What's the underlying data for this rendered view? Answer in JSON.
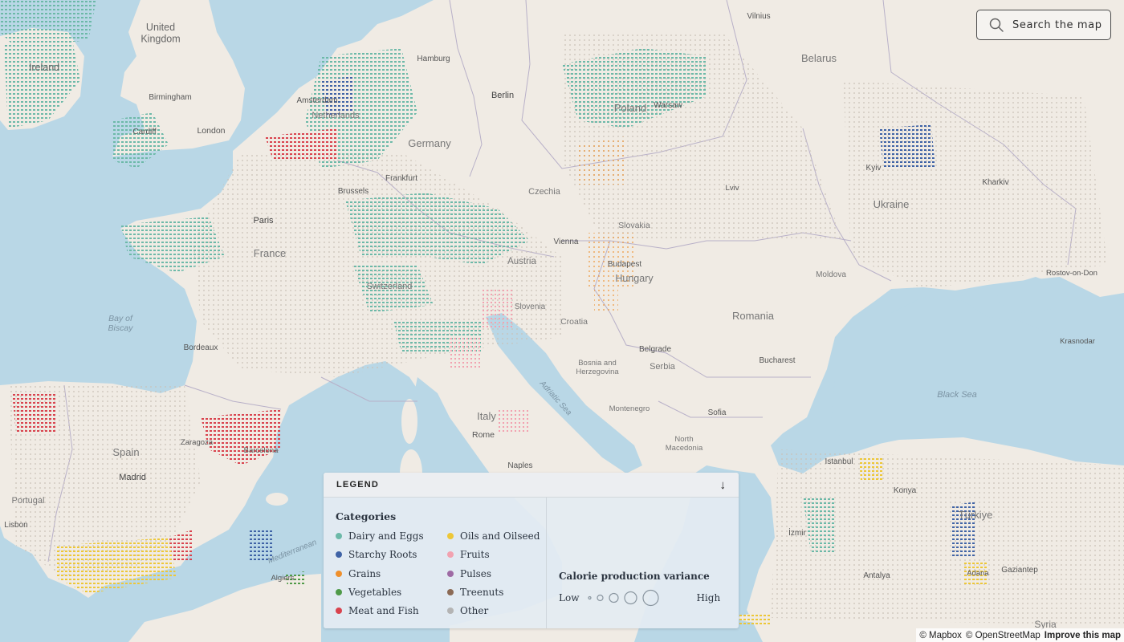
{
  "colors": {
    "water": "#b9d7e6",
    "land": "#f0ebe4",
    "dairy_eggs": "#6cb9a8",
    "starchy_roots": "#3f63a6",
    "grains": "#ef8f2b",
    "vegetables": "#4f9a48",
    "meat_fish": "#d9434e",
    "oils_oilseed": "#edc737",
    "fruits": "#f2a2b0",
    "pulses": "#9e6aa4",
    "treenuts": "#8b6a55",
    "other": "#b4b4b4"
  },
  "search": {
    "placeholder": "Search the map",
    "icon": "search-icon"
  },
  "map_labels": {
    "united_kingdom": "United\nKingdom",
    "ireland": "Ireland",
    "birmingham": "Birmingham",
    "cardiff": "Cardiff",
    "london": "London",
    "amsterdam": "Amsterdam",
    "netherlands": "Netherlands",
    "hamburg": "Hamburg",
    "berlin": "Berlin",
    "germany": "Germany",
    "frankfurt": "Frankfurt",
    "brussels": "Brussels",
    "paris": "Paris",
    "france": "France",
    "bay_of_biscay": "Bay of\nBiscay",
    "bordeaux": "Bordeaux",
    "switzerland": "Switzerland",
    "poland": "Poland",
    "warsaw": "Warsaw",
    "czechia": "Czechia",
    "vienna": "Vienna",
    "austria": "Austria",
    "slovakia": "Slovakia",
    "budapest": "Budapest",
    "hungary": "Hungary",
    "slovenia": "Slovenia",
    "croatia": "Croatia",
    "bosnia": "Bosnia and\nHerzegovina",
    "serbia": "Serbia",
    "belgrade": "Belgrade",
    "montenegro": "Montenegro",
    "north_macedonia": "North\nMacedonia",
    "sofia": "Sofia",
    "romania": "Romania",
    "bucharest": "Bucharest",
    "moldova": "Moldova",
    "ukraine": "Ukraine",
    "kyiv": "Kyiv",
    "lviv": "Lviv",
    "kharkiv": "Kharkiv",
    "belarus": "Belarus",
    "vilnius": "Vilnius",
    "rostov": "Rostov-on-Don",
    "krasnodar": "Krasnodar",
    "black_sea": "Black Sea",
    "istanbul": "Istanbul",
    "izmir": "İzmir",
    "antalya": "Antalya",
    "turkiye": "Türkiye",
    "gaziantep": "Gaziantep",
    "adana": "Adana",
    "konya": "Konya",
    "syria": "Syria",
    "italy": "Italy",
    "rome": "Rome",
    "naples": "Naples",
    "adriatic_sea": "Adriatic Sea",
    "spain": "Spain",
    "madrid": "Madrid",
    "zaragoza": "Zaragoza",
    "barcelona": "Barcelona",
    "portugal": "Portugal",
    "lisbon": "Lisbon",
    "mediterranean": "Mediterranean",
    "algiers": "Algiers"
  },
  "legend": {
    "title": "LEGEND",
    "toggle_icon": "arrow-down-icon",
    "categories_heading": "Categories",
    "categories": [
      {
        "label": "Dairy and Eggs",
        "color": "#6cb9a8"
      },
      {
        "label": "Starchy Roots",
        "color": "#3f63a6"
      },
      {
        "label": "Grains",
        "color": "#ef8f2b"
      },
      {
        "label": "Vegetables",
        "color": "#4f9a48"
      },
      {
        "label": "Meat and Fish",
        "color": "#d9434e"
      },
      {
        "label": "Oils and Oilseed",
        "color": "#edc737"
      },
      {
        "label": "Fruits",
        "color": "#f2a2b0"
      },
      {
        "label": "Pulses",
        "color": "#9e6aa4"
      },
      {
        "label": "Treenuts",
        "color": "#8b6a55"
      },
      {
        "label": "Other",
        "color": "#b4b4b4"
      }
    ],
    "variance_heading": "Calorie production variance",
    "variance_low": "Low",
    "variance_high": "High",
    "variance_steps": 5
  },
  "attribution": {
    "mapbox": "© Mapbox",
    "osm": "© OpenStreetMap",
    "improve": "Improve this map"
  }
}
